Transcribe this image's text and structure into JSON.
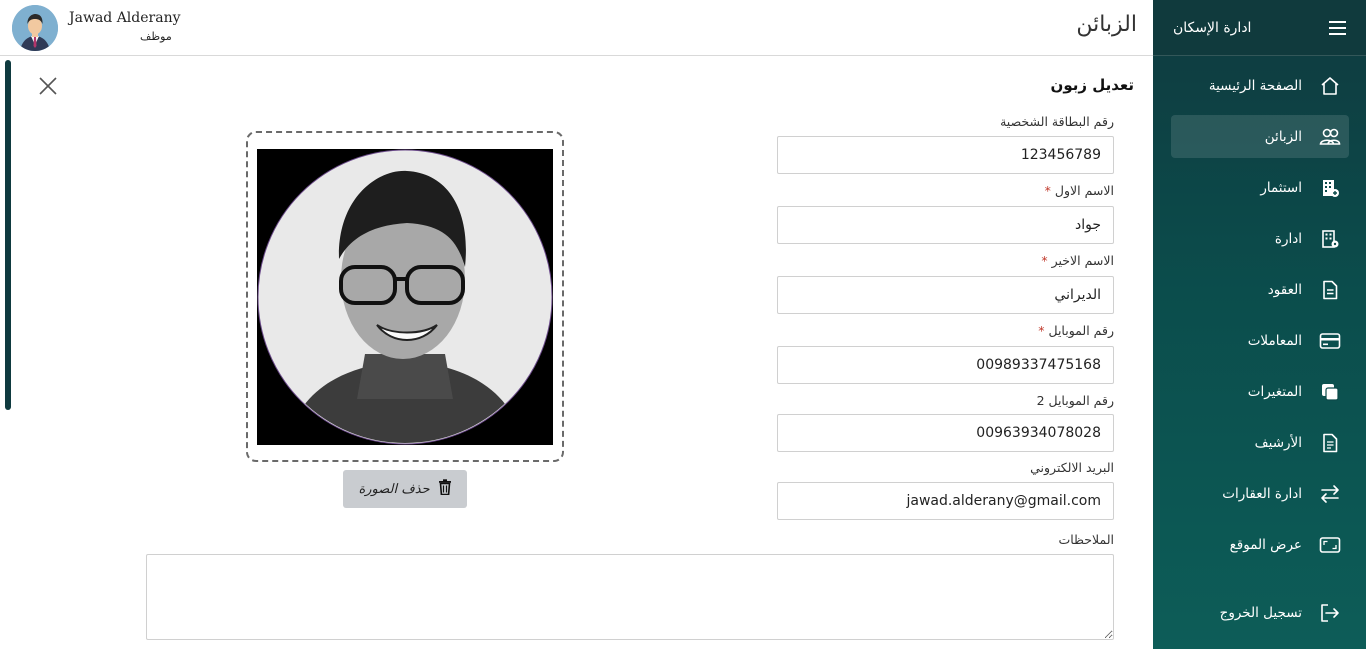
{
  "sidebar": {
    "app_title": "ادارة الإسكان",
    "items": [
      {
        "label": "الصفحة الرئيسية",
        "icon": "home-icon"
      },
      {
        "label": "الزبائن",
        "icon": "users-icon"
      },
      {
        "label": "استثمار",
        "icon": "building-plus-icon"
      },
      {
        "label": "ادارة",
        "icon": "building-gear-icon"
      },
      {
        "label": "العقود",
        "icon": "document-icon"
      },
      {
        "label": "المعاملات",
        "icon": "credit-card-icon"
      },
      {
        "label": "المتغيرات",
        "icon": "copy-icon"
      },
      {
        "label": "الأرشيف",
        "icon": "archive-document-icon"
      },
      {
        "label": "ادارة العقارات",
        "icon": "swap-arrows-icon"
      },
      {
        "label": "عرض الموقع",
        "icon": "screen-icon"
      }
    ],
    "logout_label": "تسجيل الخروج",
    "active_index": 1
  },
  "header": {
    "page_title": "الزبائن",
    "user_name": "Jawad Alderany",
    "user_role": "موظف"
  },
  "form": {
    "title": "تعديل زبون",
    "id_label": "رقم البطاقة الشخصية",
    "id_value": "123456789",
    "first_name_label": "الاسم الاول",
    "first_name_value": "جواد",
    "last_name_label": "الاسم الاخير",
    "last_name_value": "الديراني",
    "mobile_label": "رقم الموبايل",
    "mobile_value": "00989337475168",
    "mobile2_label": "رقم الموبايل 2",
    "mobile2_value": "00963934078028",
    "email_label": "البريد الالكتروني",
    "email_value": "jawad.alderany@gmail.com",
    "notes_label": "الملاحظات",
    "notes_value": "",
    "required_mark": "*",
    "delete_photo_label": "حذف الصورة"
  },
  "colors": {
    "sidebar_bg": "#0f3a3f",
    "required": "#c0392b",
    "delete_button_bg": "#c9ccd0"
  }
}
